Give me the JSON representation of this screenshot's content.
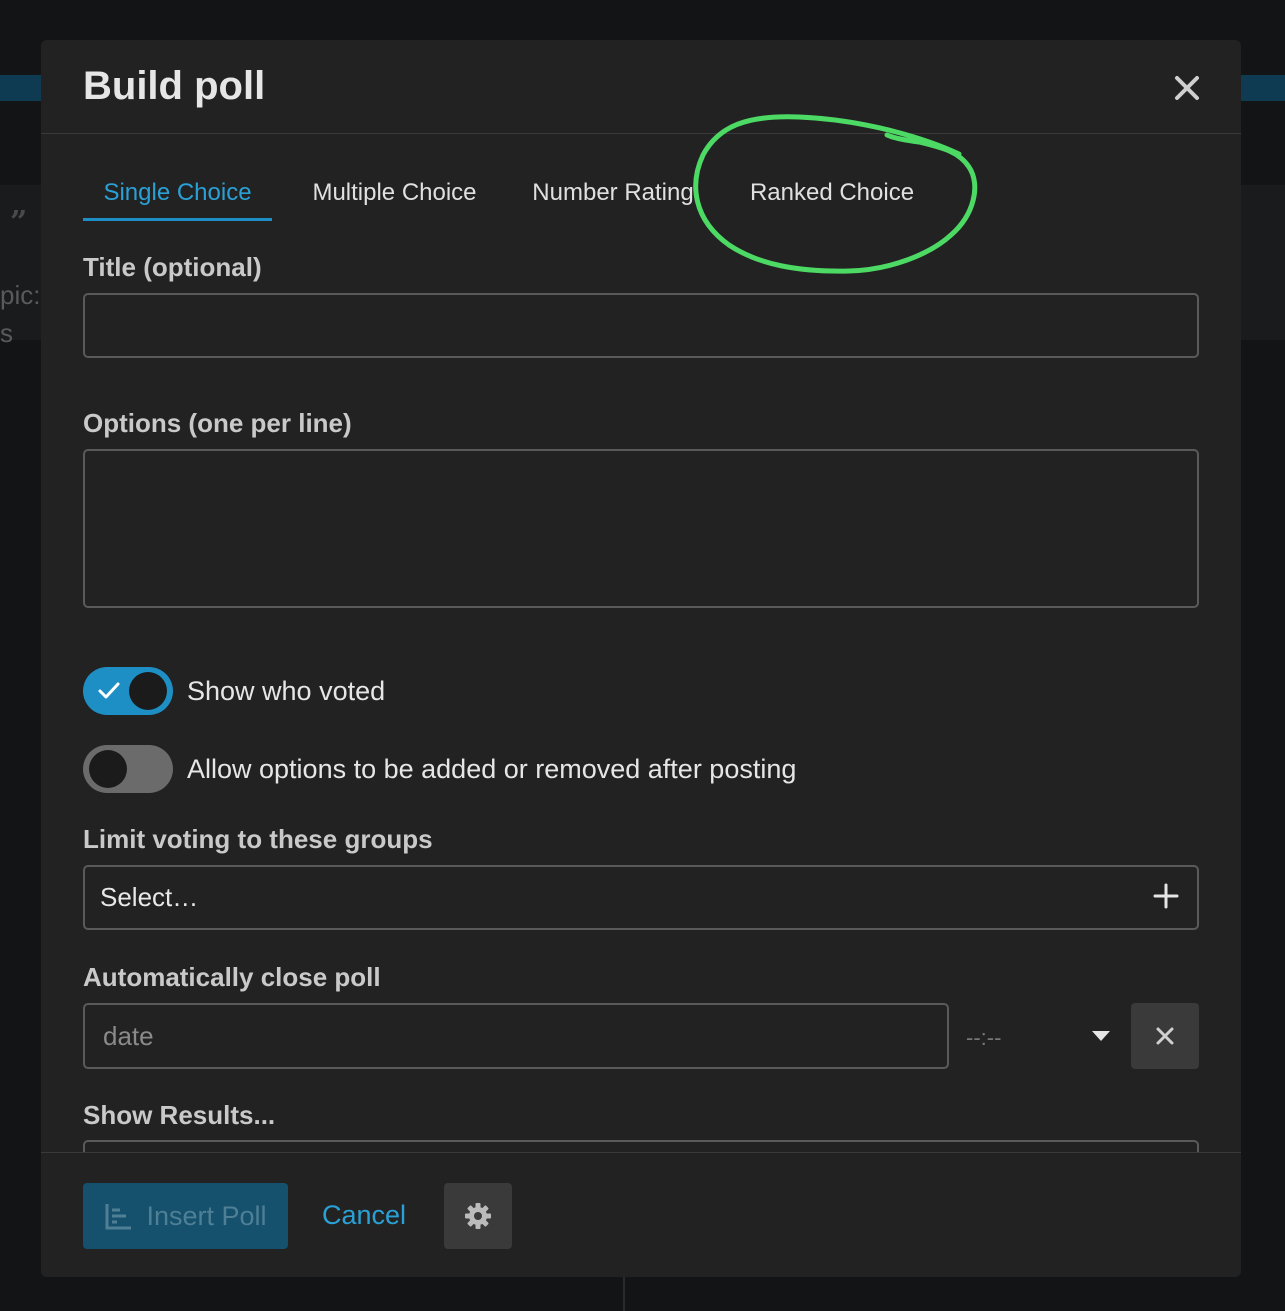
{
  "background": {
    "quote_glyph": "”",
    "text_line1": "pic:",
    "text_line2": "s"
  },
  "modal": {
    "title": "Build poll",
    "close_icon": "close-icon"
  },
  "tabs": [
    {
      "label": "Single Choice",
      "active": true
    },
    {
      "label": "Multiple Choice",
      "active": false
    },
    {
      "label": "Number Rating",
      "active": false
    },
    {
      "label": "Ranked Choice",
      "active": false,
      "annotated": true
    }
  ],
  "annotation": {
    "color": "#4cd964",
    "shape": "hand-drawn circle"
  },
  "form": {
    "title_label": "Title (optional)",
    "title_value": "",
    "options_label": "Options (one per line)",
    "options_value": "",
    "show_who_voted": {
      "label": "Show who voted",
      "enabled": true
    },
    "allow_options_edit": {
      "label": "Allow options to be added or removed after posting",
      "enabled": false
    },
    "groups_label": "Limit voting to these groups",
    "groups_placeholder": "Select…",
    "auto_close_label": "Automatically close poll",
    "date_placeholder": "date",
    "time_placeholder": "--:--",
    "show_results_label": "Show Results..."
  },
  "footer": {
    "insert_label": "Insert Poll",
    "cancel_label": "Cancel",
    "settings_icon": "gear-icon"
  },
  "colors": {
    "accent": "#1e8fc4",
    "accent_text": "#2aa1d6",
    "modal_bg": "#222222"
  }
}
